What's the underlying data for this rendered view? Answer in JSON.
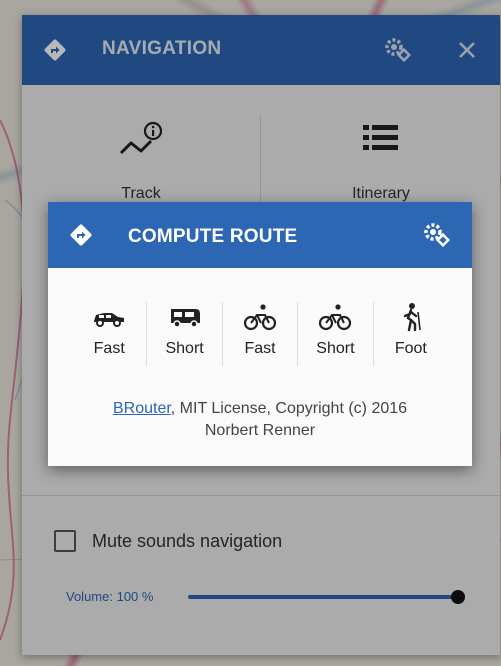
{
  "navigation": {
    "title": "NAVIGATION",
    "header_icons": [
      "navigation-diamond-icon",
      "settings-gears-icon",
      "close-icon"
    ],
    "tiles": [
      {
        "label": "Track",
        "icon": "track-info-icon"
      },
      {
        "label": "Itinerary",
        "icon": "list-icon"
      }
    ],
    "mute_label": "Mute sounds navigation",
    "mute_checked": false,
    "volume_label": "Volume: 100 %",
    "volume_fraction": 1.0
  },
  "dialog": {
    "title": "COMPUTE ROUTE",
    "profiles": [
      {
        "label": "Fast",
        "icon": "car-icon"
      },
      {
        "label": "Short",
        "icon": "van-icon"
      },
      {
        "label": "Fast",
        "icon": "road-bike-icon"
      },
      {
        "label": "Short",
        "icon": "mountain-bike-icon"
      },
      {
        "label": "Foot",
        "icon": "hiker-icon"
      }
    ],
    "credit_link": "BRouter",
    "credit_line1_rest": ", MIT License, Copyright (c) 2016",
    "credit_line2": "Norbert Renner"
  },
  "colors": {
    "accent": "#2d66b3",
    "panel": "#ededed",
    "dialog": "#fafafa"
  }
}
